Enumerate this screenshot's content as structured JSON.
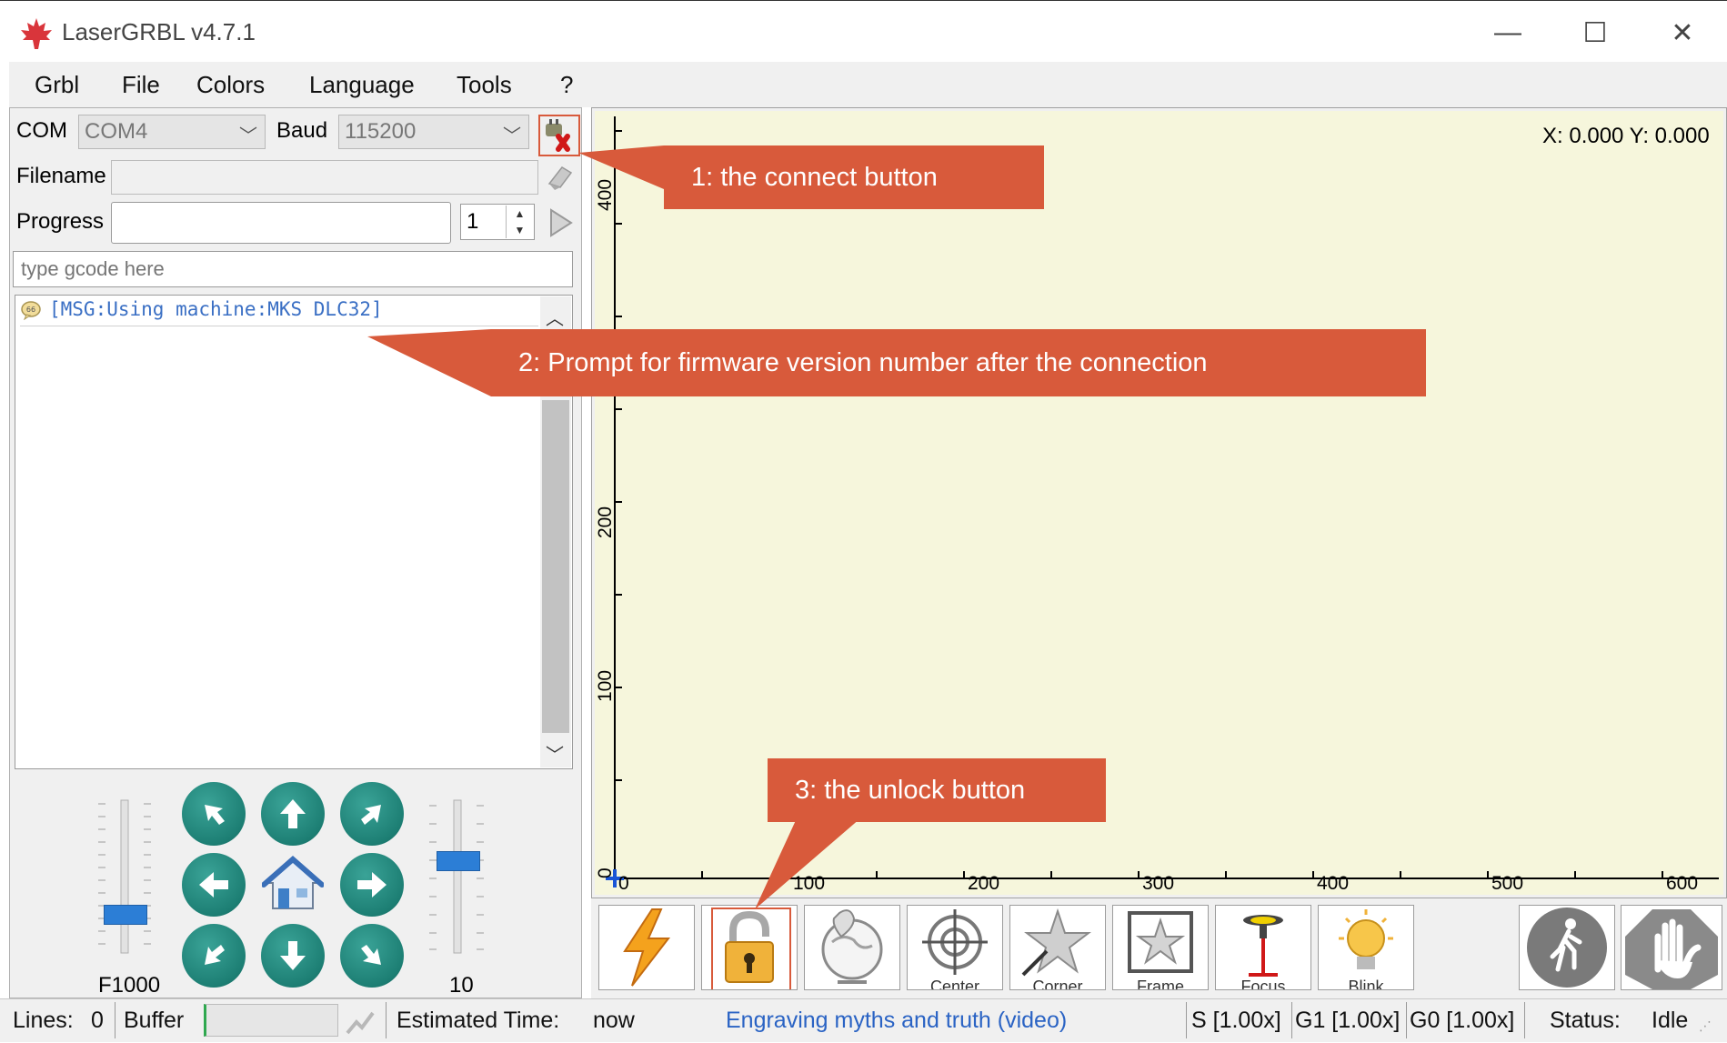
{
  "window": {
    "title": "LaserGRBL v4.7.1",
    "minimize_glyph": "—",
    "maximize_glyph": "☐",
    "close_glyph": "✕"
  },
  "menu": [
    "Grbl",
    "File",
    "Colors",
    "Language",
    "Tools",
    "?"
  ],
  "connection": {
    "com_label": "COM",
    "com_value": "COM4",
    "baud_label": "Baud",
    "baud_value": "115200"
  },
  "file": {
    "filename_label": "Filename",
    "filename_value": "",
    "progress_label": "Progress",
    "copies_value": "1"
  },
  "gcode_input": {
    "placeholder": "type gcode here"
  },
  "log": {
    "lines": [
      "[MSG:Using machine:MKS DLC32]"
    ]
  },
  "jog": {
    "speed_label": "F1000",
    "step_label": "10",
    "speed_slider_fraction": 0.22,
    "step_slider_fraction": 0.62
  },
  "canvas": {
    "coord_readout": "X: 0.000 Y: 0.000",
    "x_ticks": [
      "0",
      "100",
      "200",
      "300",
      "400",
      "500",
      "600"
    ],
    "y_ticks": [
      "0",
      "100",
      "200",
      "400"
    ],
    "background_color": "#f6f6dc"
  },
  "toolbar": {
    "items": [
      {
        "name": "laser",
        "caption": ""
      },
      {
        "name": "unlock",
        "caption": ""
      },
      {
        "name": "home-globe",
        "caption": ""
      },
      {
        "name": "center",
        "caption": "Center"
      },
      {
        "name": "corner",
        "caption": "Corner"
      },
      {
        "name": "frame",
        "caption": "Frame"
      },
      {
        "name": "focus",
        "caption": "Focus"
      },
      {
        "name": "blink",
        "caption": "Blink"
      }
    ]
  },
  "status": {
    "lines_label": "Lines:",
    "lines_value": "0",
    "buffer_label": "Buffer",
    "estimated_label": "Estimated Time:",
    "estimated_value": "now",
    "link_text": "Engraving myths and truth (video)",
    "s_override": "S [1.00x]",
    "g1_override": "G1 [1.00x]",
    "g0_override": "G0 [1.00x]",
    "status_label": "Status:",
    "status_value": "Idle"
  },
  "annotations": {
    "callout1": "1:  the connect button",
    "callout2": "2:  Prompt for firmware version number after the connection",
    "callout3": "3:  the unlock button",
    "color": "#d85a3b"
  }
}
